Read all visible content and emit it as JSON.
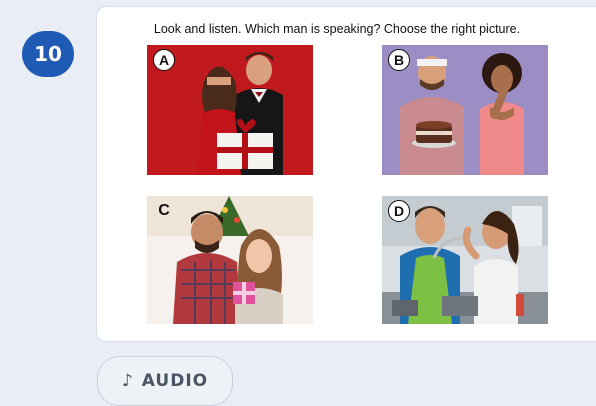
{
  "question": {
    "number": "10",
    "prompt": "Look and listen. Which man is speaking? Choose the right picture.",
    "options": [
      {
        "label": "A"
      },
      {
        "label": "B"
      },
      {
        "label": "C"
      },
      {
        "label": "D"
      }
    ]
  },
  "audio_button": {
    "icon": "♪",
    "label": "AUDIO"
  }
}
